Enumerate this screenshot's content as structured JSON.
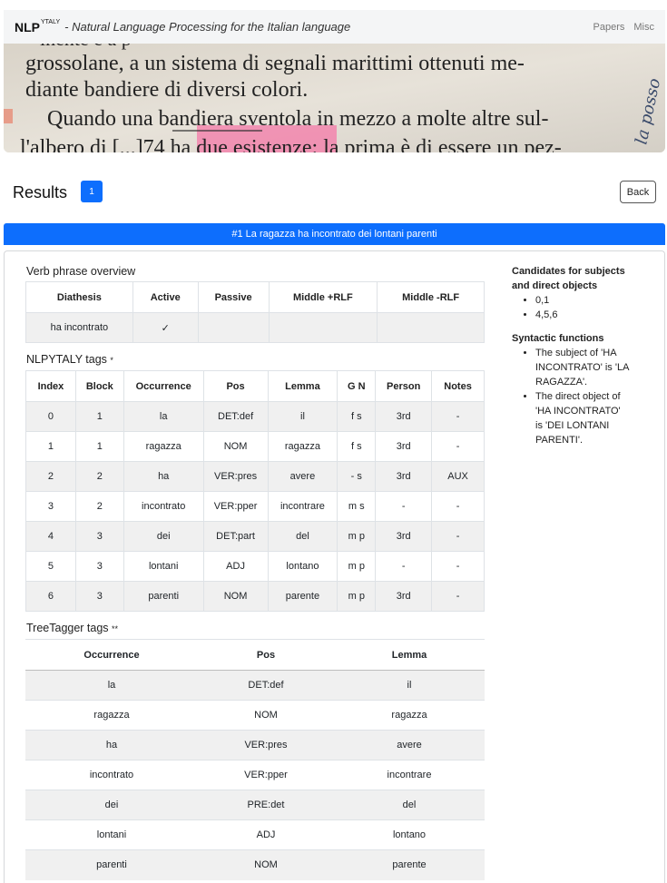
{
  "navbar": {
    "brand": "NLP",
    "brand_sup": "YTALY",
    "tagline": "- Natural Language Processing for the Italian language",
    "links": [
      "Papers",
      "Misc"
    ]
  },
  "hero": {
    "lines": [
      "grossolane, a un sistema di segnali marittimi ottenuti me-",
      "diante bandiere di diversi colori.",
      "Quando una bandiera sventola in mezzo a molte altre sul-",
      "l'albero di [...]74 ha due esistenze: la prima è di essere un pez-"
    ],
    "margin_note": "la posso"
  },
  "results": {
    "title": "Results",
    "count": "1",
    "back_label": "Back"
  },
  "result": {
    "header": "#1 La ragazza ha incontrato dei lontani parenti",
    "verb_phrase": {
      "title": "Verb phrase overview",
      "headers": [
        "Diathesis",
        "Active",
        "Passive",
        "Middle +RLF",
        "Middle -RLF"
      ],
      "row": [
        "ha incontrato",
        "✓",
        "",
        "",
        ""
      ]
    },
    "nlpytaly": {
      "title": "NLPYTALY tags",
      "mark": "*",
      "headers": [
        "Index",
        "Block",
        "Occurrence",
        "Pos",
        "Lemma",
        "G N",
        "Person",
        "Notes"
      ],
      "rows": [
        [
          "0",
          "1",
          "la",
          "DET:def",
          "il",
          "f s",
          "3rd",
          "-"
        ],
        [
          "1",
          "1",
          "ragazza",
          "NOM",
          "ragazza",
          "f s",
          "3rd",
          "-"
        ],
        [
          "2",
          "2",
          "ha",
          "VER:pres",
          "avere",
          "- s",
          "3rd",
          "AUX"
        ],
        [
          "3",
          "2",
          "incontrato",
          "VER:pper",
          "incontrare",
          "m s",
          "-",
          "-"
        ],
        [
          "4",
          "3",
          "dei",
          "DET:part",
          "del",
          "m p",
          "3rd",
          "-"
        ],
        [
          "5",
          "3",
          "lontani",
          "ADJ",
          "lontano",
          "m p",
          "-",
          "-"
        ],
        [
          "6",
          "3",
          "parenti",
          "NOM",
          "parente",
          "m p",
          "3rd",
          "-"
        ]
      ]
    },
    "treetagger": {
      "title": "TreeTagger tags",
      "mark": "**",
      "headers": [
        "Occurrence",
        "Pos",
        "Lemma"
      ],
      "rows": [
        [
          "la",
          "DET:def",
          "il"
        ],
        [
          "ragazza",
          "NOM",
          "ragazza"
        ],
        [
          "ha",
          "VER:pres",
          "avere"
        ],
        [
          "incontrato",
          "VER:pper",
          "incontrare"
        ],
        [
          "dei",
          "PRE:det",
          "del"
        ],
        [
          "lontani",
          "ADJ",
          "lontano"
        ],
        [
          "parenti",
          "NOM",
          "parente"
        ]
      ]
    },
    "candidates": {
      "title": "Candidates for subjects and direct objects",
      "items": [
        "0,1",
        "4,5,6"
      ]
    },
    "syntactic": {
      "title": "Syntactic functions",
      "items": [
        "The subject of 'HA INCONTRATO' is 'LA RAGAZZA'.",
        "The direct object of 'HA INCONTRATO' is 'DEI LONTANI PARENTI'."
      ]
    }
  }
}
